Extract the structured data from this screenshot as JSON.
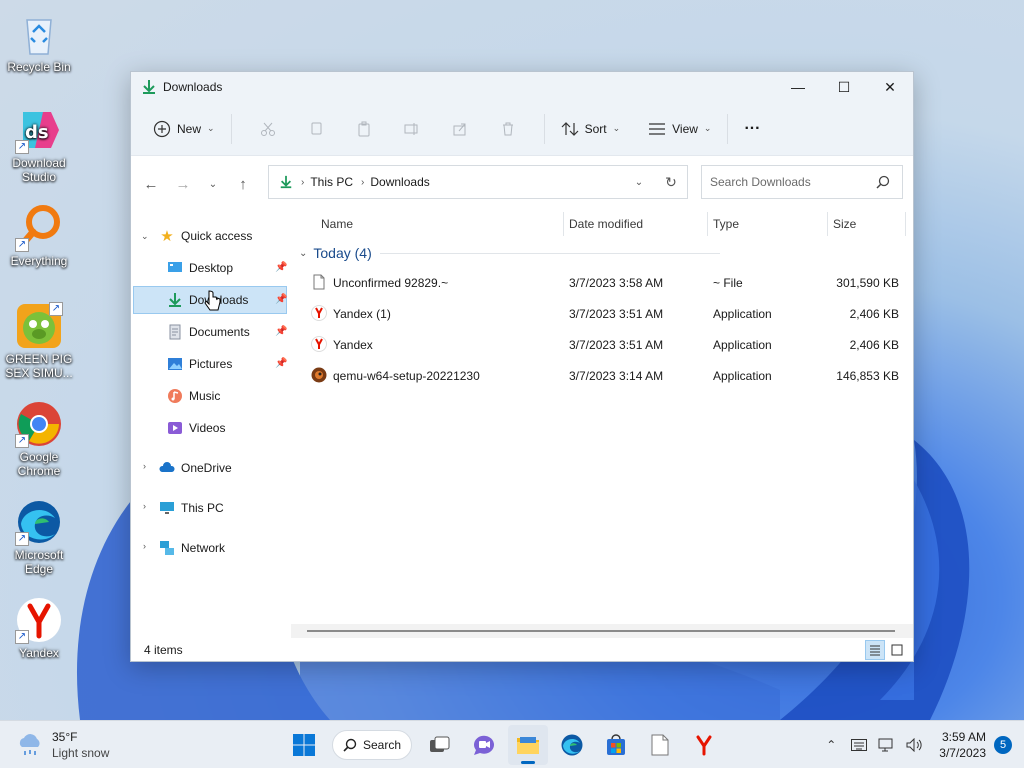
{
  "desktop": {
    "icons": [
      {
        "label": "Recycle Bin"
      },
      {
        "label": "Download Studio"
      },
      {
        "label": "Everything"
      },
      {
        "label": "GREEN PIG SEX SIMU..."
      },
      {
        "label": "Google Chrome"
      },
      {
        "label": "Microsoft Edge"
      },
      {
        "label": "Yandex"
      }
    ]
  },
  "window": {
    "title": "Downloads",
    "controls": {
      "minimize": "—",
      "maximize": "☐",
      "close": "✕"
    }
  },
  "toolbar": {
    "new_label": "New",
    "sort_label": "Sort",
    "view_label": "View",
    "more_label": "···"
  },
  "address": {
    "crumbs": [
      "This PC",
      "Downloads"
    ],
    "search_placeholder": "Search Downloads"
  },
  "navpane": {
    "quick_access": "Quick access",
    "items": [
      {
        "label": "Desktop",
        "pinned": true
      },
      {
        "label": "Downloads",
        "pinned": true
      },
      {
        "label": "Documents",
        "pinned": true
      },
      {
        "label": "Pictures",
        "pinned": true
      },
      {
        "label": "Music",
        "pinned": false
      },
      {
        "label": "Videos",
        "pinned": false
      }
    ],
    "roots": [
      "OneDrive",
      "This PC",
      "Network"
    ]
  },
  "columns": {
    "name": "Name",
    "date": "Date modified",
    "type": "Type",
    "size": "Size"
  },
  "group": {
    "label": "Today (4)"
  },
  "files": [
    {
      "name": "Unconfirmed 92829.~",
      "date": "3/7/2023 3:58 AM",
      "type": "~ File",
      "size": "301,590 KB",
      "icon": "blank-file-icon"
    },
    {
      "name": "Yandex (1)",
      "date": "3/7/2023 3:51 AM",
      "type": "Application",
      "size": "2,406 KB",
      "icon": "yandex-icon"
    },
    {
      "name": "Yandex",
      "date": "3/7/2023 3:51 AM",
      "type": "Application",
      "size": "2,406 KB",
      "icon": "yandex-icon"
    },
    {
      "name": "qemu-w64-setup-20221230",
      "date": "3/7/2023 3:14 AM",
      "type": "Application",
      "size": "146,853 KB",
      "icon": "qemu-icon"
    }
  ],
  "status": {
    "items": "4 items"
  },
  "taskbar": {
    "weather_temp": "35°F",
    "weather_desc": "Light snow",
    "search_label": "Search",
    "time": "3:59 AM",
    "date": "3/7/2023",
    "notifications": "5"
  },
  "colors": {
    "accent": "#0067c0",
    "selection": "#cce4f7",
    "yandex_red": "#e61400"
  }
}
